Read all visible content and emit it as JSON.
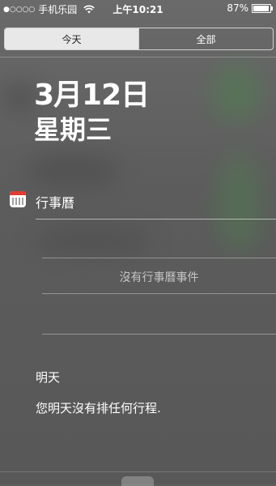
{
  "status_bar": {
    "signal": "●○○○○",
    "carrier": "手机乐园",
    "time": "上午10:21",
    "battery_text": "87%",
    "battery_level": 0.87
  },
  "tabs": [
    {
      "label": "今天",
      "active": true
    },
    {
      "label": "全部",
      "active": false
    }
  ],
  "today": {
    "date": "3月12日",
    "weekday": "星期三"
  },
  "calendar": {
    "title": "行事曆",
    "empty_text": "沒有行事曆事件"
  },
  "tomorrow": {
    "label": "明天",
    "message": "您明天沒有排任何行程."
  },
  "colors": {
    "calendar_icon_red": "#e23b30",
    "background": "#5e5e5e"
  }
}
